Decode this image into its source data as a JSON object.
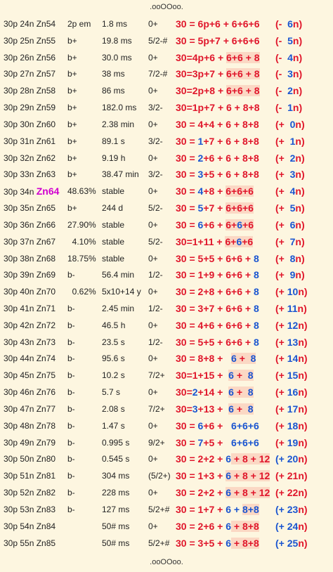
{
  "decor": {
    "top": ".ooOOoo.",
    "bottom": ".ooOOoo."
  },
  "colors": {
    "background": "#fdf6e0",
    "red": "#e0162b",
    "blue": "#1a55d0",
    "magenta": "#d000d0",
    "highlight": "#fbd8c4"
  },
  "rows": [
    {
      "iso": "30p 24n Zn54",
      "abund": "2p em",
      "half": "1.8 ms",
      "spin": "0+",
      "eq": [
        [
          "30 = 6p+6 + ",
          "r",
          0
        ],
        [
          "6+6+6",
          "r",
          0
        ]
      ],
      "delta": [
        [
          "(-",
          "r"
        ],
        [
          "  6",
          "b"
        ],
        [
          "n)",
          "r"
        ]
      ]
    },
    {
      "iso": "30p 25n Zn55",
      "abund": "b+",
      "half": "19.8 ms",
      "spin": "5/2-#",
      "eq": [
        [
          "30 = 5p+7 + ",
          "r",
          0
        ],
        [
          "6+6+6",
          "r",
          0
        ]
      ],
      "delta": [
        [
          "(-",
          "r"
        ],
        [
          "  5",
          "b"
        ],
        [
          "n)",
          "r"
        ]
      ]
    },
    {
      "iso": "30p 26n Zn56",
      "abund": "b+",
      "half": "30.0 ms",
      "spin": "0+",
      "eq": [
        [
          "30=4p+6 + ",
          "r",
          0
        ],
        [
          "6+6 + 8",
          "r",
          1
        ]
      ],
      "delta": [
        [
          "(-",
          "r"
        ],
        [
          "  4",
          "b"
        ],
        [
          "n)",
          "r"
        ]
      ]
    },
    {
      "iso": "30p 27n Zn57",
      "abund": "b+",
      "half": "38 ms",
      "spin": "7/2-#",
      "eq": [
        [
          "30=3p+7 + ",
          "r",
          0
        ],
        [
          "6+6 + 8",
          "r",
          1
        ]
      ],
      "delta": [
        [
          "(-",
          "r"
        ],
        [
          "  3",
          "b"
        ],
        [
          "n)",
          "r"
        ]
      ]
    },
    {
      "iso": "30p 28n Zn58",
      "abund": "b+",
      "half": "86 ms",
      "spin": "0+",
      "eq": [
        [
          "30=2p+8 + ",
          "r",
          0
        ],
        [
          "6+6 + 8",
          "r",
          1
        ]
      ],
      "delta": [
        [
          "(-",
          "r"
        ],
        [
          "  2",
          "b"
        ],
        [
          "n)",
          "r"
        ]
      ]
    },
    {
      "iso": "30p 29n Zn59",
      "abund": "b+",
      "half": "182.0 ms",
      "spin": "3/2-",
      "eq": [
        [
          "30=1p+7 + 6 + 8+8",
          "r",
          0
        ]
      ],
      "delta": [
        [
          "(-",
          "r"
        ],
        [
          "  1",
          "b"
        ],
        [
          "n)",
          "r"
        ]
      ]
    },
    {
      "iso": "30p 30n Zn60",
      "abund": "b+",
      "half": "2.38 min",
      "spin": "0+",
      "eq": [
        [
          "30 = 4+4 + 6 + 8+8",
          "r",
          0
        ]
      ],
      "delta": [
        [
          "(+",
          "r"
        ],
        [
          "  0",
          "b"
        ],
        [
          "n)",
          "r"
        ]
      ]
    },
    {
      "iso": "30p 31n Zn61",
      "abund": "b+",
      "half": "89.1 s",
      "spin": "3/2-",
      "eq": [
        [
          "30 = ",
          "r",
          0
        ],
        [
          "1",
          "b",
          0
        ],
        [
          "+7 + 6 + 8+8",
          "r",
          0
        ]
      ],
      "delta": [
        [
          "(+",
          "r"
        ],
        [
          "  1",
          "b"
        ],
        [
          "n)",
          "r"
        ]
      ]
    },
    {
      "iso": "30p 32n Zn62",
      "abund": "b+",
      "half": "9.19 h",
      "spin": "0+",
      "eq": [
        [
          "30 = ",
          "r",
          0
        ],
        [
          "2",
          "b",
          0
        ],
        [
          "+6 + 6 + 8+8",
          "r",
          0
        ]
      ],
      "delta": [
        [
          "(+",
          "r"
        ],
        [
          "  2",
          "b"
        ],
        [
          "n)",
          "r"
        ]
      ]
    },
    {
      "iso": "30p 33n Zn63",
      "abund": "b+",
      "half": "38.47 min",
      "spin": "3/2-",
      "eq": [
        [
          "30 = ",
          "r",
          0
        ],
        [
          "3",
          "b",
          0
        ],
        [
          "+5 + 6 + 8+8",
          "r",
          0
        ]
      ],
      "delta": [
        [
          "(+",
          "r"
        ],
        [
          "  3",
          "b"
        ],
        [
          "n)",
          "r"
        ]
      ]
    },
    {
      "iso": "30p 34n ",
      "iso_hl": "Zn64",
      "abund": "48.63%",
      "half": "stable",
      "spin": "0+",
      "eq": [
        [
          "30 = ",
          "r",
          0
        ],
        [
          "4",
          "b",
          0
        ],
        [
          "+8 + ",
          "r",
          0
        ],
        [
          "6+6+6",
          "r",
          1
        ]
      ],
      "delta": [
        [
          "(+",
          "r"
        ],
        [
          "  4",
          "b"
        ],
        [
          "n)",
          "r"
        ]
      ]
    },
    {
      "iso": "30p 35n Zn65",
      "abund": "b+",
      "half": "244 d",
      "spin": "5/2-",
      "eq": [
        [
          "30 = ",
          "r",
          0
        ],
        [
          "5",
          "b",
          0
        ],
        [
          "+7 + ",
          "r",
          0
        ],
        [
          "6+6+6",
          "r",
          1
        ]
      ],
      "delta": [
        [
          "(+",
          "r"
        ],
        [
          "  5",
          "b"
        ],
        [
          "n)",
          "r"
        ]
      ]
    },
    {
      "iso": "30p 36n Zn66",
      "abund": "27.90%",
      "half": "stable",
      "spin": "0+",
      "eq": [
        [
          "30 = ",
          "r",
          0
        ],
        [
          "6",
          "b",
          0
        ],
        [
          "+6 + ",
          "r",
          0
        ],
        [
          "6",
          "r",
          1
        ],
        [
          "+",
          "r",
          1
        ],
        [
          "6",
          "b",
          1
        ],
        [
          "+6",
          "r",
          1
        ]
      ],
      "delta": [
        [
          "(+",
          "r"
        ],
        [
          "  6",
          "b"
        ],
        [
          "n)",
          "r"
        ]
      ]
    },
    {
      "iso": "30p 37n Zn67",
      "abund": "  4.10%",
      "half": "stable",
      "spin": "5/2-",
      "eq": [
        [
          "30=1+11 + ",
          "r",
          0
        ],
        [
          "6+",
          "r",
          1
        ],
        [
          "6",
          "b",
          1
        ],
        [
          "+6",
          "r",
          1
        ]
      ],
      "delta": [
        [
          "(+",
          "r"
        ],
        [
          "  7",
          "b"
        ],
        [
          "n)",
          "r"
        ]
      ]
    },
    {
      "iso": "30p 38n Zn68",
      "abund": "18.75%",
      "half": "stable",
      "spin": "0+",
      "eq": [
        [
          "30 = 5+5 + 6+6 + ",
          "r",
          0
        ],
        [
          "8",
          "b",
          0
        ]
      ],
      "delta": [
        [
          "(+",
          "r"
        ],
        [
          "  8",
          "b"
        ],
        [
          "n)",
          "r"
        ]
      ]
    },
    {
      "iso": "30p 39n Zn69",
      "abund": "b-",
      "half": "56.4 min",
      "spin": "1/2-",
      "eq": [
        [
          "30 = 1+9 + 6+6 + ",
          "r",
          0
        ],
        [
          "8",
          "b",
          0
        ]
      ],
      "delta": [
        [
          "(+",
          "r"
        ],
        [
          "  9",
          "b"
        ],
        [
          "n)",
          "r"
        ]
      ]
    },
    {
      "iso": "30p 40n Zn70",
      "abund": "  0.62%",
      "half": "5x10+14 y",
      "spin": "0+",
      "eq": [
        [
          "30 = 2+8 + 6+6 + ",
          "r",
          0
        ],
        [
          "8",
          "b",
          0
        ]
      ],
      "delta": [
        [
          "(+",
          "r"
        ],
        [
          " 10",
          "b"
        ],
        [
          "n)",
          "r"
        ]
      ]
    },
    {
      "iso": "30p 41n Zn71",
      "abund": "b-",
      "half": "2.45 min",
      "spin": "1/2-",
      "eq": [
        [
          "30 = 3+7 + 6+6 + ",
          "r",
          0
        ],
        [
          "8",
          "b",
          0
        ]
      ],
      "delta": [
        [
          "(+",
          "r"
        ],
        [
          " 11",
          "b"
        ],
        [
          "n)",
          "r"
        ]
      ]
    },
    {
      "iso": "30p 42n Zn72",
      "abund": "b-",
      "half": "46.5 h",
      "spin": "0+",
      "eq": [
        [
          "30 = 4+6 + 6+6 + ",
          "r",
          0
        ],
        [
          "8",
          "b",
          0
        ]
      ],
      "delta": [
        [
          "(+",
          "r"
        ],
        [
          " 12",
          "b"
        ],
        [
          "n)",
          "r"
        ]
      ]
    },
    {
      "iso": "30p 43n Zn73",
      "abund": "b-",
      "half": "23.5 s",
      "spin": "1/2-",
      "eq": [
        [
          "30 = 5+5 + 6+6 + ",
          "r",
          0
        ],
        [
          "8",
          "b",
          0
        ]
      ],
      "delta": [
        [
          "(+",
          "r"
        ],
        [
          " 13",
          "b"
        ],
        [
          "n)",
          "r"
        ]
      ]
    },
    {
      "iso": "30p 44n Zn74",
      "abund": "b-",
      "half": "95.6 s",
      "spin": "0+",
      "eq": [
        [
          "30 = 8+8 +   ",
          "r",
          0
        ],
        [
          "6",
          "b",
          1
        ],
        [
          " + ",
          "r",
          1
        ],
        [
          " 8",
          "b",
          1
        ]
      ],
      "delta": [
        [
          "(+",
          "r"
        ],
        [
          " 14",
          "b"
        ],
        [
          "n)",
          "r"
        ]
      ]
    },
    {
      "iso": "30p 45n Zn75",
      "abund": "b-",
      "half": "10.2 s",
      "spin": "7/2+",
      "eq": [
        [
          "30=1+15 +  ",
          "r",
          0
        ],
        [
          "6",
          "b",
          1
        ],
        [
          " + ",
          "r",
          1
        ],
        [
          " 8",
          "b",
          1
        ]
      ],
      "delta": [
        [
          "(+",
          "r"
        ],
        [
          " 15",
          "b"
        ],
        [
          "n)",
          "r"
        ]
      ]
    },
    {
      "iso": "30p 46n Zn76",
      "abund": "b-",
      "half": "5.7 s",
      "spin": "0+",
      "eq": [
        [
          "30=",
          "r",
          0
        ],
        [
          "2",
          "b",
          0
        ],
        [
          "+14 +  ",
          "r",
          0
        ],
        [
          "6",
          "b",
          1
        ],
        [
          " + ",
          "r",
          1
        ],
        [
          " 8",
          "b",
          1
        ]
      ],
      "delta": [
        [
          "(+",
          "r"
        ],
        [
          " 16",
          "b"
        ],
        [
          "n)",
          "r"
        ]
      ]
    },
    {
      "iso": "30p 47n Zn77",
      "abund": "b-",
      "half": "2.08 s",
      "spin": "7/2+",
      "eq": [
        [
          "30=",
          "r",
          0
        ],
        [
          "3",
          "b",
          0
        ],
        [
          "+13 +  ",
          "r",
          0
        ],
        [
          "6",
          "b",
          1
        ],
        [
          " + ",
          "r",
          1
        ],
        [
          " 8",
          "b",
          1
        ]
      ],
      "delta": [
        [
          "(+",
          "r"
        ],
        [
          " 17",
          "b"
        ],
        [
          "n)",
          "r"
        ]
      ]
    },
    {
      "iso": "30p 48n Zn78",
      "abund": "b-",
      "half": "1.47 s",
      "spin": "0+",
      "eq": [
        [
          "30 = ",
          "r",
          0
        ],
        [
          "6",
          "b",
          0
        ],
        [
          "+6 +   ",
          "r",
          0
        ],
        [
          "6+6+6",
          "b",
          0
        ]
      ],
      "delta": [
        [
          "(+",
          "r"
        ],
        [
          " 18",
          "b"
        ],
        [
          "n)",
          "r"
        ]
      ]
    },
    {
      "iso": "30p 49n Zn79",
      "abund": "b-",
      "half": "0.995 s",
      "spin": "9/2+",
      "eq": [
        [
          "30 = ",
          "r",
          0
        ],
        [
          "7",
          "b",
          0
        ],
        [
          "+5 +   ",
          "r",
          0
        ],
        [
          "6+6+6",
          "b",
          0
        ]
      ],
      "delta": [
        [
          "(+",
          "r"
        ],
        [
          " 19",
          "b"
        ],
        [
          "n)",
          "r"
        ]
      ]
    },
    {
      "iso": "30p 50n Zn80",
      "abund": "b-",
      "half": "0.545 s",
      "spin": "0+",
      "eq": [
        [
          "30 = 2+2 + ",
          "r",
          0
        ],
        [
          "6",
          "b",
          0
        ],
        [
          " + 8 + 12",
          "r",
          1
        ]
      ],
      "delta": [
        [
          "(+ 20",
          "b"
        ],
        [
          "n)",
          "r"
        ]
      ]
    },
    {
      "iso": "30p 51n Zn81",
      "abund": "b-",
      "half": "304 ms",
      "spin": "(5/2+)",
      "eq": [
        [
          "30 = 1+3 + ",
          "r",
          0
        ],
        [
          "6",
          "b",
          1
        ],
        [
          " + 8 + 12",
          "r",
          1
        ]
      ],
      "delta": [
        [
          "(+ 21",
          "r"
        ],
        [
          "n)",
          "r"
        ]
      ]
    },
    {
      "iso": "30p 52n Zn82",
      "abund": "b-",
      "half": "228 ms",
      "spin": "0+",
      "eq": [
        [
          "30 = 2+2 + ",
          "r",
          0
        ],
        [
          "6",
          "b",
          1
        ],
        [
          " + 8 + 12",
          "r",
          1
        ]
      ],
      "delta": [
        [
          "(+ 22",
          "r"
        ],
        [
          "n)",
          "r"
        ]
      ]
    },
    {
      "iso": "30p 53n Zn83",
      "abund": "b-",
      "half": "127 ms",
      "spin": "5/2+#",
      "eq": [
        [
          "30 = 1+7 + ",
          "r",
          0
        ],
        [
          "6 + ",
          "b",
          0
        ],
        [
          "8+8",
          "b",
          1
        ]
      ],
      "delta": [
        [
          "(+ 23",
          "b"
        ],
        [
          "n)",
          "r"
        ]
      ]
    },
    {
      "iso": "30p 54n Zn84",
      "abund": "",
      "half": "50# ms",
      "spin": "0+",
      "eq": [
        [
          "30 = 2+6 + ",
          "r",
          0
        ],
        [
          "6",
          "b",
          0
        ],
        [
          " + 8+8",
          "r",
          1
        ]
      ],
      "delta": [
        [
          "(+ 24",
          "b"
        ],
        [
          "n)",
          "r"
        ]
      ]
    },
    {
      "iso": "30p 55n Zn85",
      "abund": "",
      "half": "50# ms",
      "spin": "5/2+#",
      "eq": [
        [
          "30 = 3+5 + ",
          "r",
          0
        ],
        [
          "6",
          "b",
          0
        ],
        [
          " + 8+8",
          "r",
          1
        ]
      ],
      "delta": [
        [
          "(+ 25",
          "b"
        ],
        [
          "n)",
          "r"
        ]
      ]
    }
  ]
}
